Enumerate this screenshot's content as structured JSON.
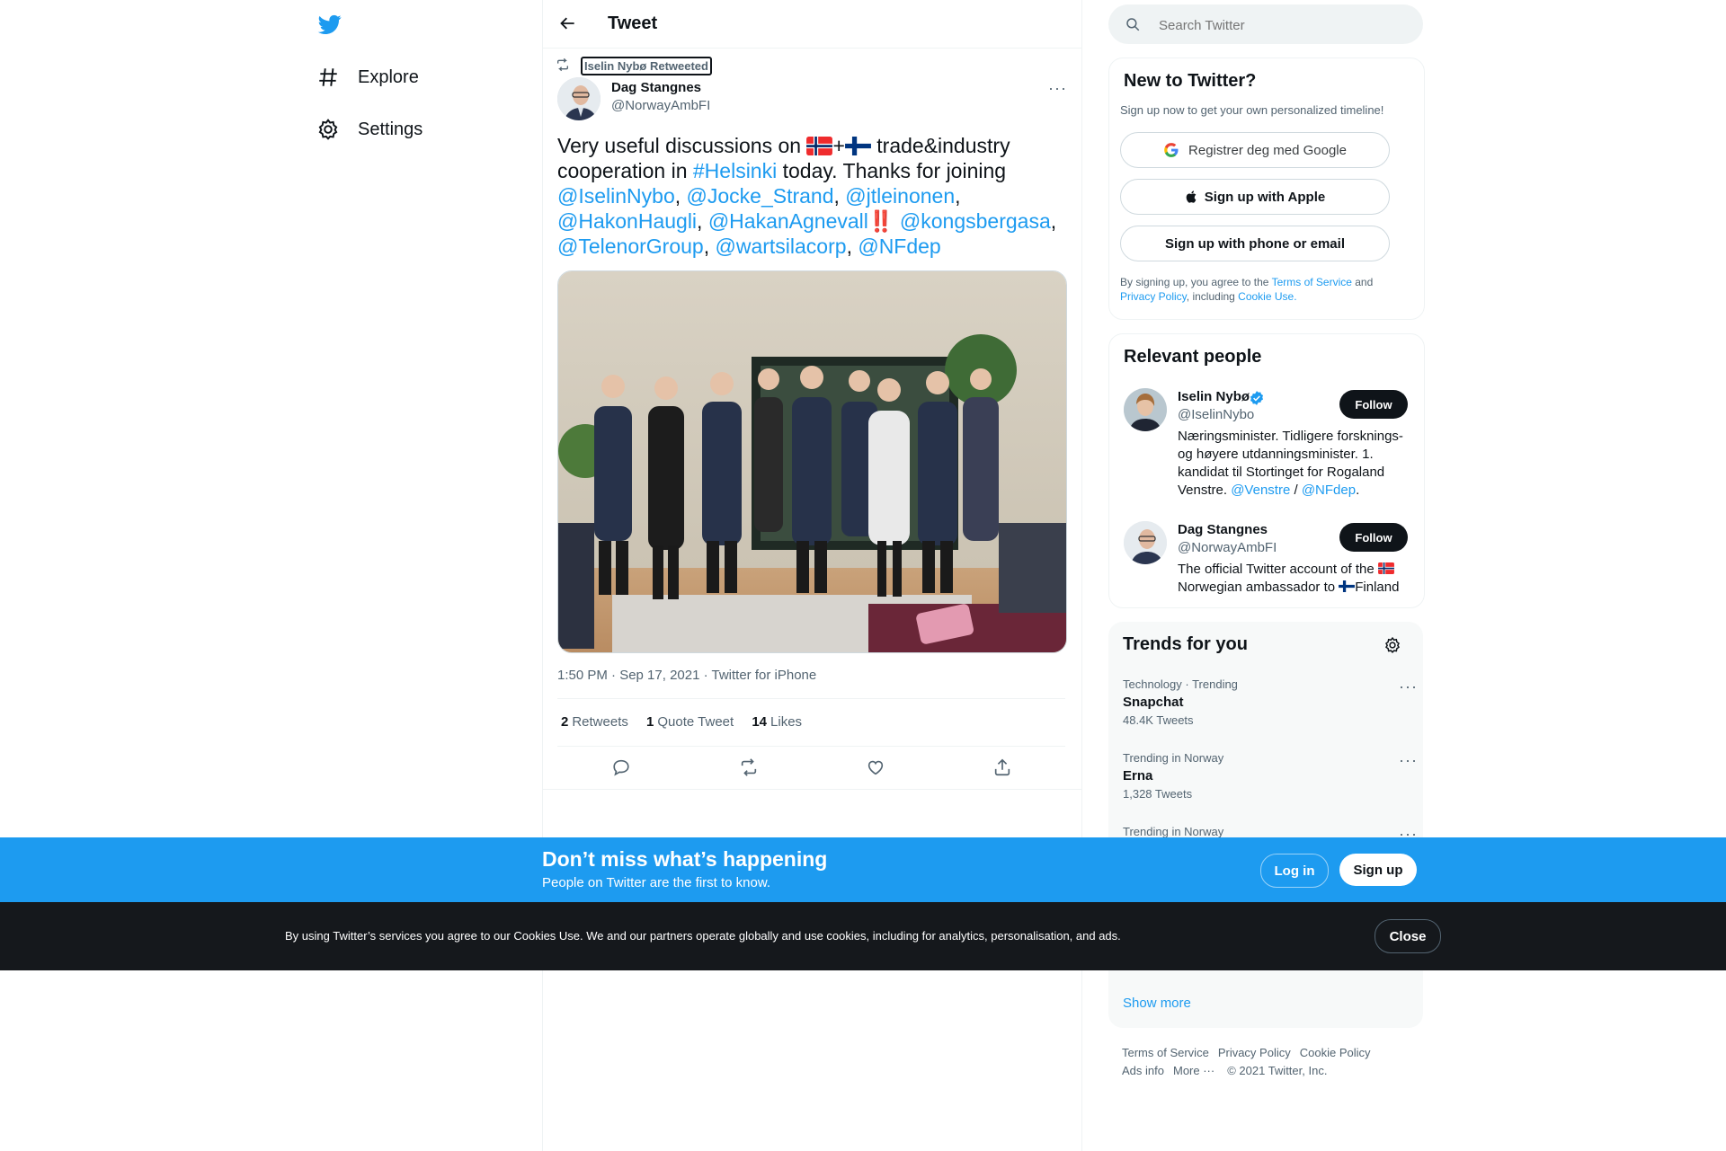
{
  "nav": {
    "explore_label": "Explore",
    "settings_label": "Settings"
  },
  "header": {
    "title": "Tweet",
    "back_icon": "arrow-left-icon"
  },
  "tweet": {
    "retweeted_by": "Iselin Nybø Retweeted",
    "author_name": "Dag Stangnes",
    "author_handle": "@NorwayAmbFI",
    "text_parts": {
      "p1": "Very useful discussions on ",
      "p2": "+",
      "p3": " trade&industry cooperation in ",
      "hashtag": "#Helsinki",
      "p4": " today. Thanks for joining ",
      "m1": "@IselinNybo",
      "m2": "@Jocke_Strand",
      "m3": "@jtleinonen",
      "m4": "@HakonHaugli",
      "m5": "@HakanAgnevall",
      "exclaim": "‼️",
      "m6": "@kongsbergasa",
      "m7": "@TelenorGroup",
      "m8": "@wartsilacorp",
      "m9": "@NFdep",
      "comma": ",",
      "comma_space": ", "
    },
    "meta": "1:50 PM · Sep 17, 2021 · Twitter for iPhone",
    "retweets_count": "2",
    "retweets_label": "Retweets",
    "quotes_count": "1",
    "quotes_label": "Quote Tweet",
    "likes_count": "14",
    "likes_label": "Likes"
  },
  "search": {
    "placeholder": "Search Twitter"
  },
  "new_to_twitter": {
    "title": "New to Twitter?",
    "subtitle": "Sign up now to get your own personalized timeline!",
    "google_label": "Registrer deg med Google",
    "apple_label": "Sign up with Apple",
    "phone_label": "Sign up with phone or email",
    "legal_1": "By signing up, you agree to the ",
    "legal_tos": "Terms of Service",
    "legal_2": " and",
    "legal_privacy": "Privacy Policy",
    "legal_3": ", including ",
    "legal_cookie": "Cookie Use."
  },
  "relevant_people": {
    "title": "Relevant people",
    "people": [
      {
        "name": "Iselin Nybø",
        "handle": "@IselinNybo",
        "follow": "Follow",
        "bio_1": "Næringsminister. Tidligere forsknings- og høyere utdanningsminister. 1. kandidat til Stortinget for Rogaland Venstre. ",
        "bio_link1": "@Venstre",
        "bio_sep": " / ",
        "bio_link2": "@NFdep",
        "bio_end": "."
      },
      {
        "name": "Dag Stangnes",
        "handle": "@NorwayAmbFI",
        "follow": "Follow",
        "bio_1": "The official Twitter account of the ",
        "bio_2": "Norwegian ambassador to ",
        "bio_3": "Finland"
      }
    ]
  },
  "trends": {
    "title": "Trends for you",
    "items": [
      {
        "context": "Technology · Trending",
        "name": "Snapchat",
        "count": "48.4K Tweets"
      },
      {
        "context": "Trending in Norway",
        "name": "Erna",
        "count": "1,328 Tweets"
      },
      {
        "context": "Trending in Norway",
        "name": "",
        "count": ""
      }
    ],
    "show_more": "Show more"
  },
  "footer": {
    "tos": "Terms of Service",
    "privacy": "Privacy Policy",
    "cookie": "Cookie Policy",
    "ads": "Ads info",
    "more": "More ···",
    "copyright": "© 2021 Twitter, Inc."
  },
  "signup_bar": {
    "title": "Don’t miss what’s happening",
    "subtitle": "People on Twitter are the first to know.",
    "login": "Log in",
    "signup": "Sign up"
  },
  "cookie_bar": {
    "text": "By using Twitter’s services you agree to our Cookies Use. We and our partners operate globally and use cookies, including for analytics, personalisation, and ads.",
    "close": "Close"
  },
  "colors": {
    "brand_blue": "#1d9bf0",
    "text": "#0f1419",
    "muted": "#536471",
    "cookie_bg": "#15181c"
  }
}
